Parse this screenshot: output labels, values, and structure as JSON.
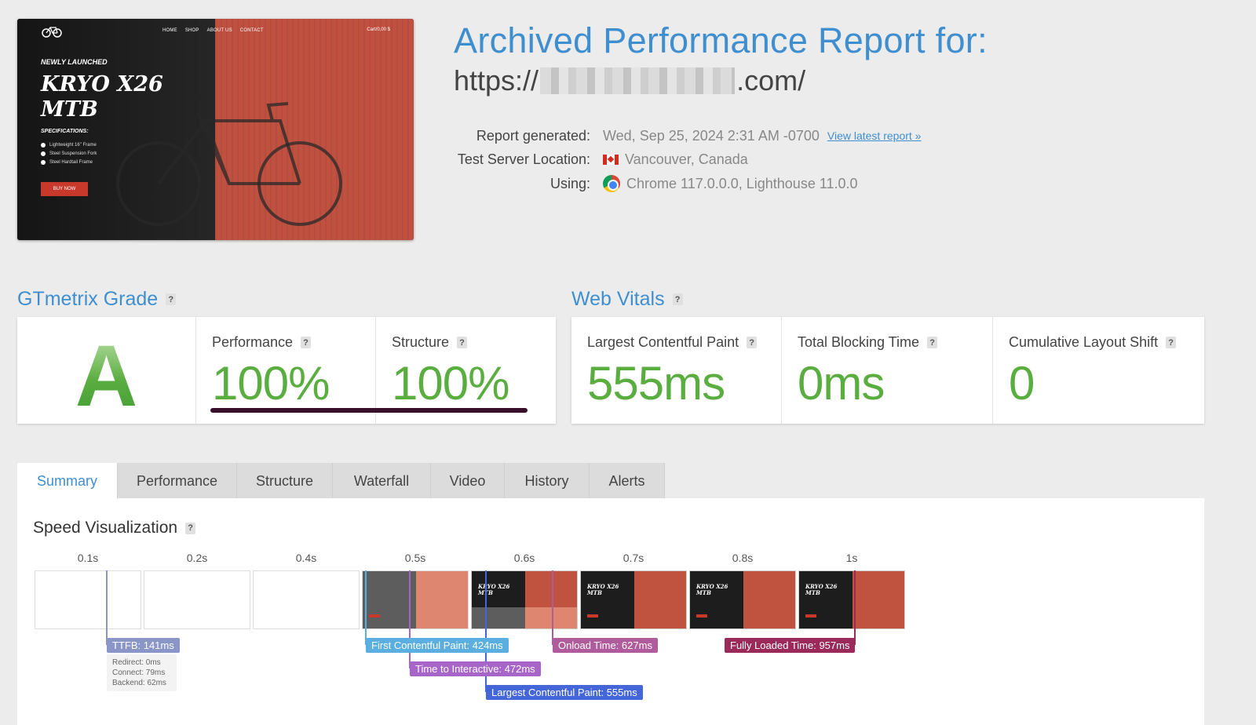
{
  "preview": {
    "nav": [
      "HOME",
      "SHOP",
      "ABOUT US",
      "CONTACT"
    ],
    "cart": "Cart/0,00 $",
    "kicker": "NEWLY LAUNCHED",
    "hero_line1": "KRYO X26",
    "hero_line2": "MTB",
    "spec_title": "SPECIFICATIONS:",
    "specs": [
      "Lightweight 16\" Frame",
      "Steel Suspension Fork",
      "Steel Hardtail Frame"
    ],
    "buy": "BUY NOW"
  },
  "header": {
    "title": "Archived Performance Report for:",
    "url_prefix": "https://",
    "url_suffix": ".com/",
    "report_generated_label": "Report generated:",
    "report_generated_value": "Wed, Sep 25, 2024 2:31 AM -0700",
    "latest_link": "View latest report »",
    "location_label": "Test Server Location:",
    "location_value": "Vancouver, Canada",
    "using_label": "Using:",
    "using_value": "Chrome 117.0.0.0, Lighthouse 11.0.0"
  },
  "grade": {
    "heading": "GTmetrix Grade",
    "letter": "A",
    "performance_label": "Performance",
    "performance_value": "100%",
    "structure_label": "Structure",
    "structure_value": "100%"
  },
  "vitals": {
    "heading": "Web Vitals",
    "lcp_label": "Largest Contentful Paint",
    "lcp_value": "555ms",
    "tbt_label": "Total Blocking Time",
    "tbt_value": "0ms",
    "cls_label": "Cumulative Layout Shift",
    "cls_value": "0"
  },
  "tabs": [
    "Summary",
    "Performance",
    "Structure",
    "Waterfall",
    "Video",
    "History",
    "Alerts"
  ],
  "speed": {
    "heading": "Speed Visualization",
    "ticks": [
      "0.1s",
      "0.2s",
      "0.4s",
      "0.5s",
      "0.6s",
      "0.7s",
      "0.8s",
      "1s"
    ],
    "frame_text_1": "KRYO X26",
    "frame_text_2": "MTB",
    "ttfb": "TTFB: 141ms",
    "redirect": "Redirect: 0ms",
    "connect": "Connect: 79ms",
    "backend": "Backend: 62ms",
    "fcp": "First Contentful Paint: 424ms",
    "tti": "Time to Interactive: 472ms",
    "lcp": "Largest Contentful Paint: 555ms",
    "onload": "Onload Time: 627ms",
    "fully_loaded": "Fully Loaded Time: 957ms"
  },
  "colors": {
    "accent": "#3f8fd0",
    "good": "#5aad3f",
    "ttfb": "#8a95c8",
    "fcp": "#5aaee0",
    "tti": "#a865c9",
    "lcp": "#4466d8",
    "onload": "#b05b9b",
    "fully_loaded": "#9b2a5a"
  }
}
